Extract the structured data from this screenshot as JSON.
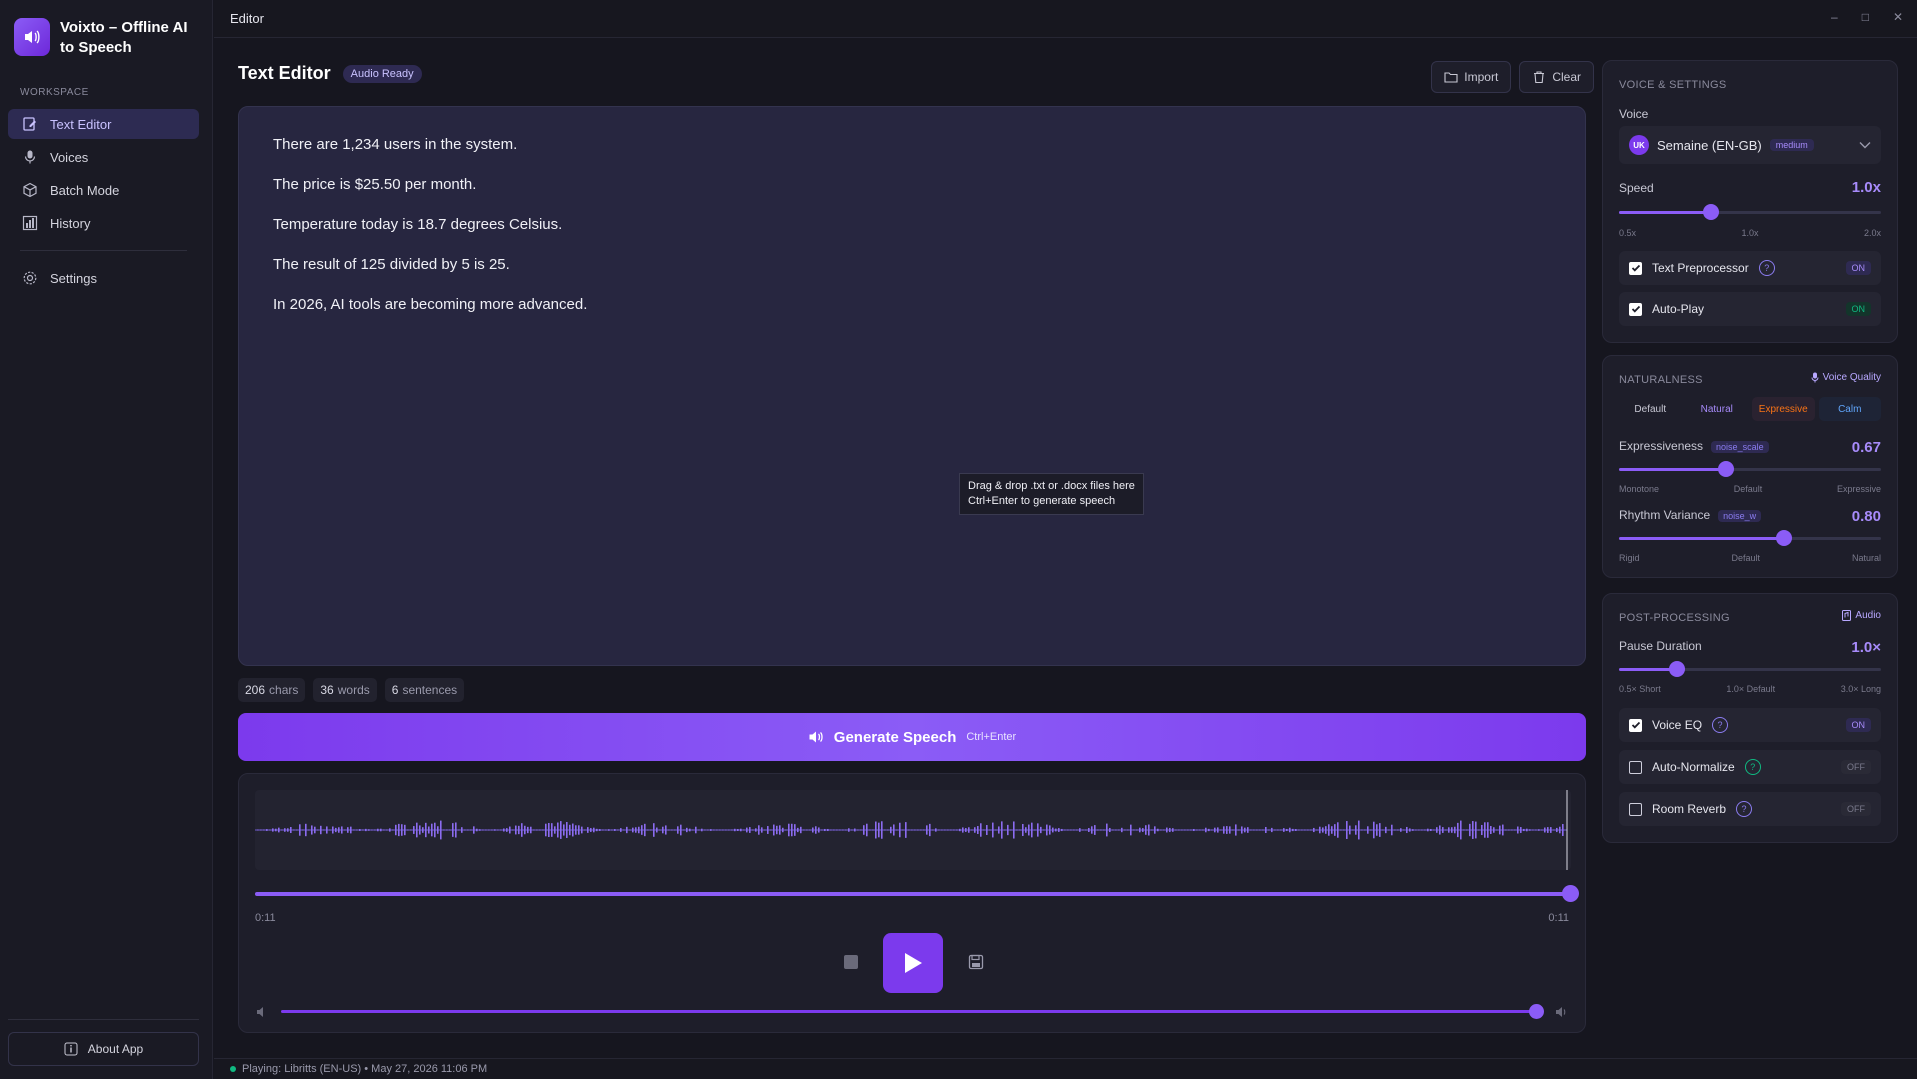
{
  "app": {
    "title": "Voixto – Offline AI to Speech",
    "window_title": "Editor"
  },
  "sidebar": {
    "section_label": "WORKSPACE",
    "items": [
      {
        "label": "Text Editor",
        "icon": "edit-icon",
        "active": true
      },
      {
        "label": "Voices",
        "icon": "microphone-icon"
      },
      {
        "label": "Batch Mode",
        "icon": "package-icon"
      },
      {
        "label": "History",
        "icon": "chart-icon"
      }
    ],
    "settings_label": "Settings",
    "about_label": "About App"
  },
  "editor": {
    "title": "Text Editor",
    "status_badge": "Audio Ready",
    "import_label": "Import",
    "clear_label": "Clear",
    "lines": [
      "There are 1,234 users in the system.",
      "The price is $25.50 per month.",
      "Temperature today is 18.7 degrees Celsius.",
      "The result of 125 divided by 5 is 25.",
      "In 2026, AI tools are becoming more advanced."
    ],
    "drop_hint_line1": "Drag & drop .txt or .docx files here",
    "drop_hint_line2": "Ctrl+Enter to generate speech",
    "stats": {
      "chars_value": "206",
      "chars_label": "chars",
      "words_value": "36",
      "words_label": "words",
      "sentences_value": "6",
      "sentences_label": "sentences"
    },
    "generate_label": "Generate Speech",
    "generate_shortcut": "Ctrl+Enter"
  },
  "player": {
    "time_current": "0:11",
    "time_total": "0:11",
    "progress_fraction": 1.0,
    "volume_fraction": 0.98
  },
  "status_bar": {
    "text": "Playing: Libritts (EN-US) • May 27, 2026  11:06 PM"
  },
  "voice_settings": {
    "title": "VOICE & SETTINGS",
    "voice_label": "Voice",
    "voice_avatar": "UK",
    "voice_name": "Semaine (EN-GB)",
    "voice_quality": "medium",
    "speed_label": "Speed",
    "speed_value": "1.0x",
    "speed_fraction": 0.35,
    "speed_ticks": [
      "0.5x",
      "1.0x",
      "2.0x"
    ],
    "text_preprocessor_label": "Text Preprocessor",
    "text_preprocessor_state": "ON",
    "autoplay_label": "Auto-Play",
    "autoplay_state": "ON"
  },
  "naturalness": {
    "title": "NATURALNESS",
    "tag": "Voice Quality",
    "presets": [
      "Default",
      "Natural",
      "Expressive",
      "Calm"
    ],
    "expressiveness_label": "Expressiveness",
    "expressiveness_tag": "noise_scale",
    "expressiveness_value": "0.67",
    "expressiveness_fraction": 0.41,
    "expressiveness_ticks": [
      "Monotone",
      "Default",
      "Expressive"
    ],
    "rhythm_label": "Rhythm Variance",
    "rhythm_tag": "noise_w",
    "rhythm_value": "0.80",
    "rhythm_fraction": 0.63,
    "rhythm_ticks": [
      "Rigid",
      "Default",
      "Natural"
    ]
  },
  "post_processing": {
    "title": "POST-PROCESSING",
    "tag": "Audio",
    "pause_label": "Pause Duration",
    "pause_value": "1.0×",
    "pause_fraction": 0.22,
    "pause_ticks": [
      "0.5× Short",
      "1.0× Default",
      "3.0× Long"
    ],
    "voice_eq_label": "Voice EQ",
    "voice_eq_state": "ON",
    "auto_normalize_label": "Auto-Normalize",
    "auto_normalize_state": "OFF",
    "room_reverb_label": "Room Reverb",
    "room_reverb_state": "OFF"
  },
  "colors": {
    "accent": "#8b5cf6",
    "accent_dark": "#7c3aed",
    "on_green": "#10b981",
    "expressive_orange": "#f97316"
  }
}
